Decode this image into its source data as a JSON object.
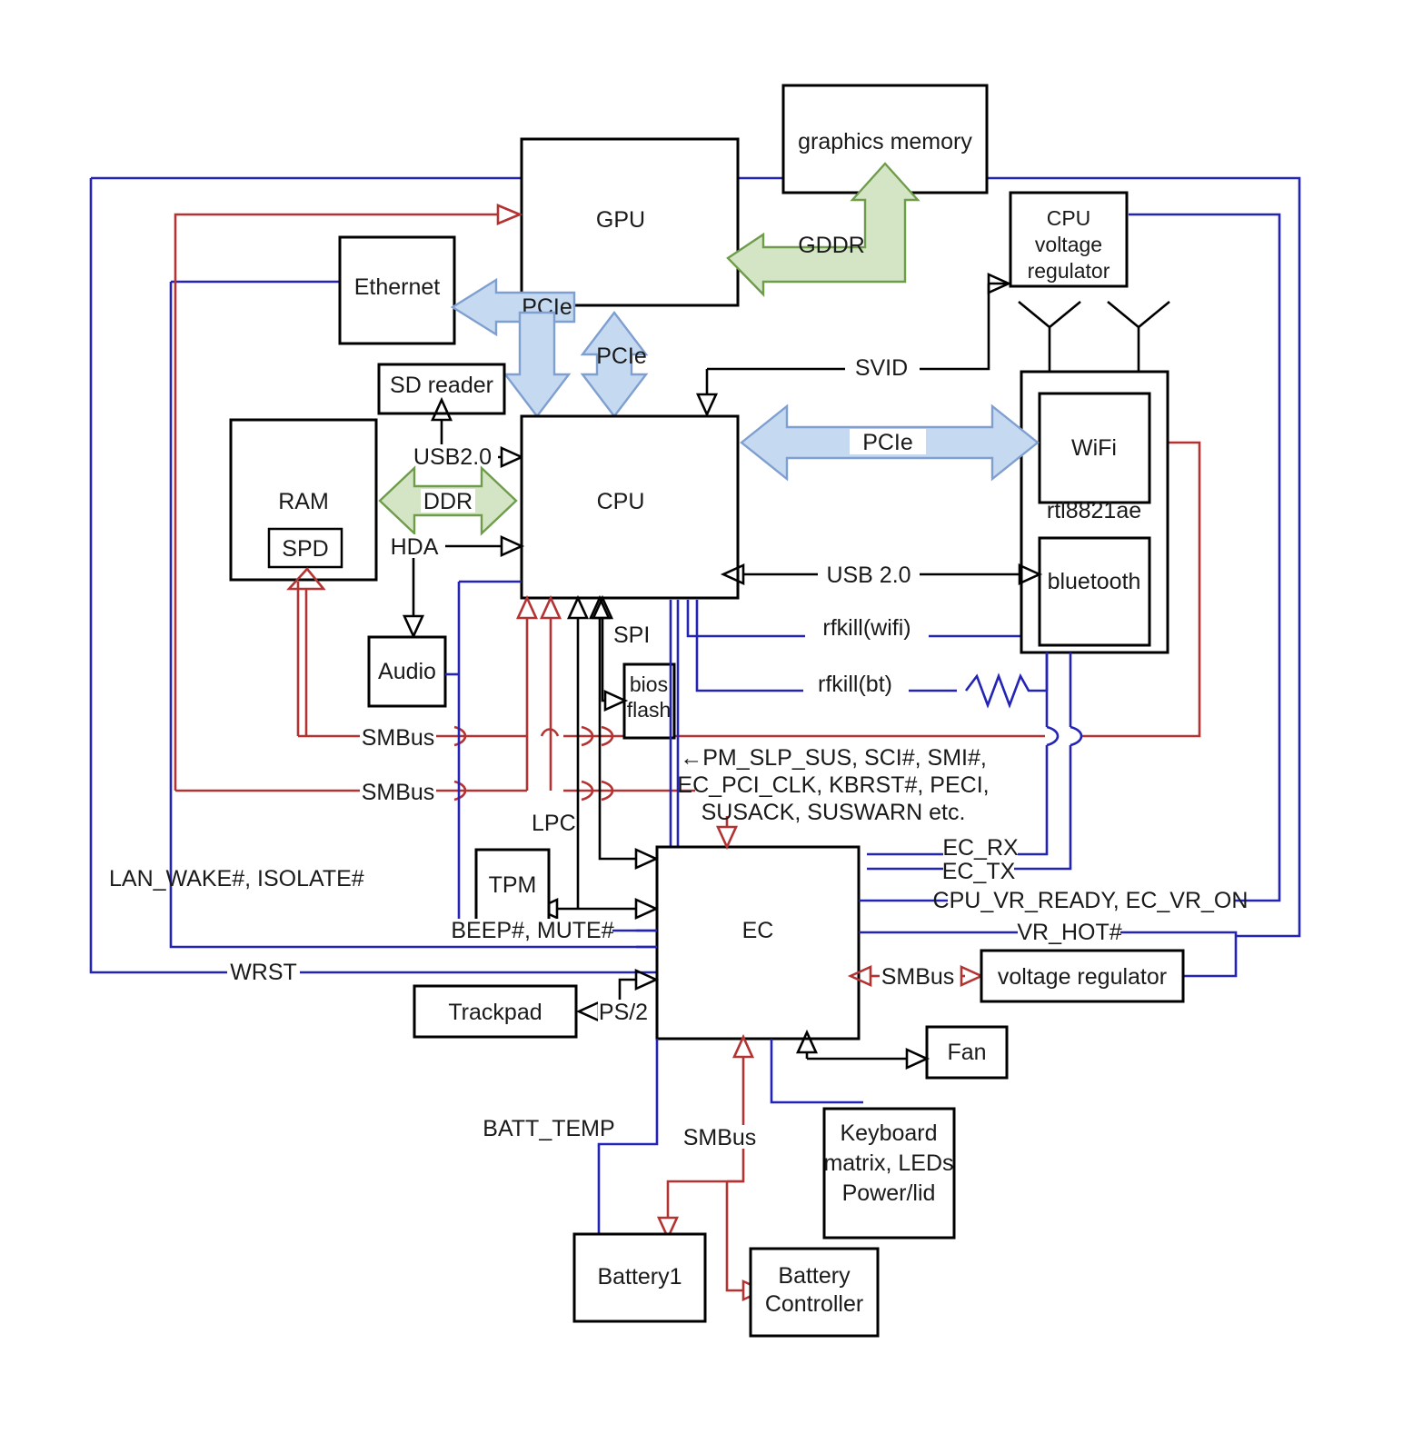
{
  "diagram": {
    "title": "Laptop mainboard block diagram",
    "colors": {
      "block_stroke": "#000000",
      "black_wire": "#000000",
      "blue_wire": "#2323b5",
      "red_wire": "#b33232",
      "pcie_arrow_fill": "#c5d9f1",
      "pcie_arrow_stroke": "#7f9fd0",
      "memory_arrow_fill": "#d3e5c4",
      "memory_arrow_stroke": "#6f9c4b",
      "background": "#ffffff"
    },
    "blocks": [
      {
        "id": "graphics_memory",
        "label": "graphics memory"
      },
      {
        "id": "gpu",
        "label": "GPU"
      },
      {
        "id": "cpu_voltage_regulator",
        "label": "CPU\nvoltage\nregulator",
        "lines": [
          "CPU",
          "voltage",
          "regulator"
        ]
      },
      {
        "id": "ethernet",
        "label": "Ethernet"
      },
      {
        "id": "sd_reader",
        "label": "SD reader"
      },
      {
        "id": "ram",
        "label": "RAM"
      },
      {
        "id": "spd",
        "label": "SPD"
      },
      {
        "id": "cpu",
        "label": "CPU"
      },
      {
        "id": "wifi_module",
        "label": "rtl8821ae"
      },
      {
        "id": "wifi",
        "label": "WiFi"
      },
      {
        "id": "bluetooth",
        "label": "bluetooth"
      },
      {
        "id": "audio",
        "label": "Audio"
      },
      {
        "id": "bios_flash",
        "label": "bios flash",
        "lines": [
          "bios",
          "flash"
        ]
      },
      {
        "id": "tpm",
        "label": "TPM"
      },
      {
        "id": "ec",
        "label": "EC"
      },
      {
        "id": "voltage_regulator",
        "label": "voltage regulator"
      },
      {
        "id": "trackpad",
        "label": "Trackpad"
      },
      {
        "id": "fan",
        "label": "Fan"
      },
      {
        "id": "keyboard_matrix",
        "label": "Keyboard matrix, LEDs Power/lid",
        "lines": [
          "Keyboard",
          "matrix, LEDs",
          "Power/lid"
        ]
      },
      {
        "id": "battery1",
        "label": "Battery1"
      },
      {
        "id": "battery_controller",
        "label": "Battery Controller",
        "lines": [
          "Battery",
          "Controller"
        ]
      }
    ],
    "bus_labels": {
      "gddr": "GDDR",
      "pcie_ethernet": "PCIe",
      "pcie_gpu": "PCIe",
      "pcie_wifi": "PCIe",
      "ddr": "DDR",
      "usb20_sd": "USB2.0",
      "hda": "HDA",
      "spi": "SPI",
      "lpc": "LPC",
      "svid": "SVID",
      "usb20_bt": "USB 2.0",
      "rfkill_wifi": "rfkill(wifi)",
      "rfkill_bt": "rfkill(bt)",
      "smbus_1": "SMBus",
      "smbus_2": "SMBus",
      "smbus_vr": "SMBus",
      "smbus_batt": "SMBus",
      "ps2": "PS/2",
      "ec_rx": "EC_RX",
      "ec_tx": "EC_TX",
      "cpu_vr_ready": "CPU_VR_READY, EC_VR_ON",
      "vr_hot": "VR_HOT#",
      "beep_mute": "BEEP#, MUTE#",
      "lan_wake": "LAN_WAKE#, ISOLATE#",
      "wrst": "WRST",
      "batt_temp": "BATT_TEMP",
      "ec_signals_line1": "←PM_SLP_SUS, SCI#, SMI#,",
      "ec_signals_line2": "EC_PCI_CLK, KBRST#, PECI,",
      "ec_signals_line3": "SUSACK, SUSWARN etc."
    }
  }
}
